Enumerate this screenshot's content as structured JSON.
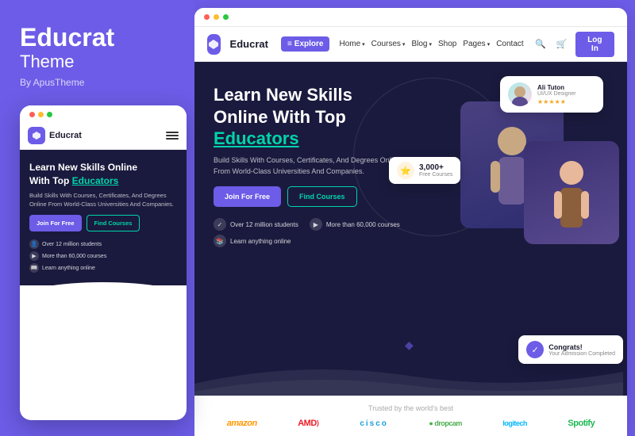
{
  "left": {
    "brand_title": "Educrat",
    "brand_sub": "Theme",
    "brand_by": "By ApusTheme",
    "mobile": {
      "brand_name": "Educrat",
      "hero_title_line1": "Learn New Skills Online",
      "hero_title_line2": "With Top",
      "hero_educators": "Educators",
      "hero_desc": "Build Skills With Courses, Certificates, And Degrees Online From World-Class Universities And Companies.",
      "btn_join": "Join For Free",
      "btn_find": "Find Courses",
      "stat1": "Over 12 million students",
      "stat2": "More than 60,000 courses",
      "stat3": "Learn anything online"
    }
  },
  "right": {
    "browser_dots": [
      "red",
      "yellow",
      "green"
    ],
    "nav": {
      "brand_name": "Educrat",
      "explore_label": "Explore",
      "links": [
        "Home",
        "Courses",
        "Blog",
        "Shop",
        "Pages",
        "Contact"
      ],
      "login_label": "Log In"
    },
    "hero": {
      "title_line1": "Learn New Skills",
      "title_line2": "Online With Top",
      "title_educators": "Educators",
      "desc": "Build Skills With Courses, Certificates, And Degrees Online From World-Class Universities And Companies.",
      "btn_join": "Join For Free",
      "btn_find": "Find Courses",
      "stat1": "Over 12 million students",
      "stat2": "More than 60,000 courses",
      "stat3": "Learn anything online"
    },
    "cards": {
      "ali_name": "Ali Tuton",
      "ali_role": "UI/UX Designer",
      "ali_stars": "★★★★★",
      "courses_num": "3,000+",
      "courses_label": "Free Courses",
      "congrats_title": "Congrats!",
      "congrats_sub": "Your Admission Completed"
    },
    "trusted": {
      "title": "Trusted by the world's best",
      "logos": [
        "amazon",
        "AMD⟩",
        "cisco",
        "dropcam",
        "logitech",
        "Spotify"
      ]
    }
  }
}
